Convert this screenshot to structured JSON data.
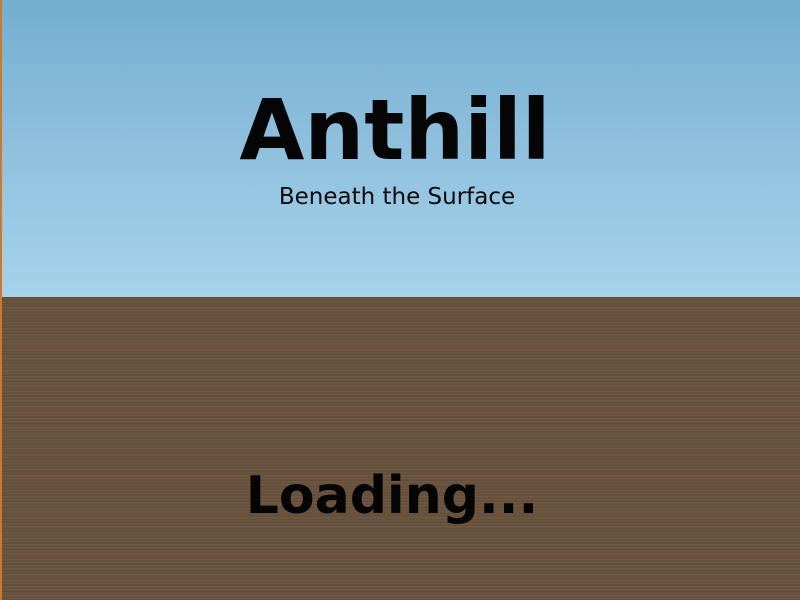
{
  "title": "Anthill",
  "subtitle": "Beneath the Surface",
  "loading_text": "Loading...",
  "colors": {
    "sky_top": "#74aed0",
    "sky_bottom": "#a6d3ea",
    "ground": "#6b543f",
    "text": "#050505"
  }
}
